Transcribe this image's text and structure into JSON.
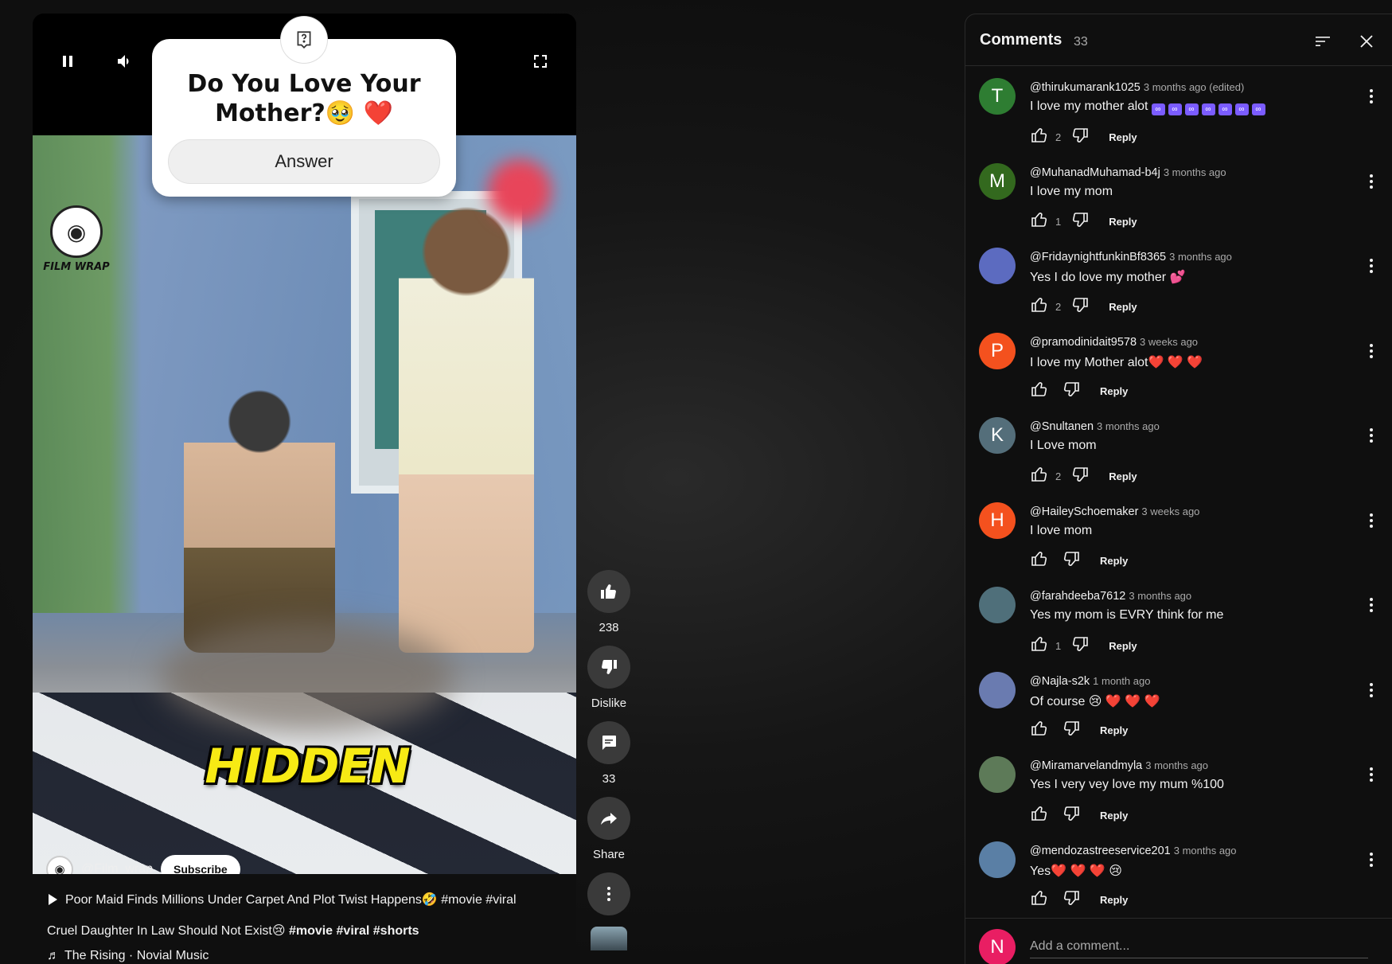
{
  "video": {
    "poll_question": "Do You Love Your Mother?🥹 ❤️",
    "poll_answer": "Answer",
    "logo_text": "FILM WRAP",
    "overlay_text": "HIDDEN",
    "channel_handle": "@Film_wrap",
    "subscribe_label": "Subscribe",
    "title": "Poor Maid Finds Millions Under Carpet And Plot Twist Happens🤣 #movie #viral",
    "description_plain": "Cruel Daughter In Law Should Not Exist😢 ",
    "description_tags": "#movie #viral #shorts",
    "music": "The Rising · Novial Music",
    "music_icon": "music-note-icon"
  },
  "actions": {
    "like_count": "238",
    "dislike_label": "Dislike",
    "comment_count": "33",
    "share_label": "Share"
  },
  "comments_panel": {
    "title": "Comments",
    "count": "33",
    "add_placeholder": "Add a comment...",
    "me_initial": "N",
    "reply_label": "Reply",
    "comments": [
      {
        "initial": "T",
        "avatar_color": "#2e7d32",
        "author": "@thirukumarank1025",
        "time": "3 months ago (edited)",
        "text": "I love my mother alot",
        "likes": "2",
        "pills": 7
      },
      {
        "initial": "M",
        "avatar_color": "#33691e",
        "author": "@MuhanadMuhamad-b4j",
        "time": "3 months ago",
        "text": "I love my mom",
        "likes": "1"
      },
      {
        "initial": "",
        "avatar_color": "#5c6bc0",
        "author": "@FridaynightfunkinBf8365",
        "time": "3 months ago",
        "text": "Yes I do love my mother 💕",
        "likes": "2"
      },
      {
        "initial": "P",
        "avatar_color": "#f4511e",
        "author": "@pramodinidait9578",
        "time": "3 weeks ago",
        "text": "I love my Mother alot❤️ ❤️ ❤️",
        "likes": ""
      },
      {
        "initial": "K",
        "avatar_color": "#546e7a",
        "author": "@Snultanen",
        "time": "3 months ago",
        "text": "I Love mom",
        "likes": "2"
      },
      {
        "initial": "H",
        "avatar_color": "#f4511e",
        "author": "@HaileySchoemaker",
        "time": "3 weeks ago",
        "text": "I love mom",
        "likes": ""
      },
      {
        "initial": "",
        "avatar_color": "#4f6f7a",
        "author": "@farahdeeba7612",
        "time": "3 months ago",
        "text": "Yes my mom is EVRY think for me",
        "likes": "1"
      },
      {
        "initial": "",
        "avatar_color": "#6a7bb0",
        "author": "@Najla-s2k",
        "time": "1 month ago",
        "text": "Of course 😢 ❤️ ❤️ ❤️",
        "likes": ""
      },
      {
        "initial": "",
        "avatar_color": "#5d7a58",
        "author": "@Miramarvelandmyla",
        "time": "3 months ago",
        "text": "Yes I very vey love my mum %100",
        "likes": ""
      },
      {
        "initial": "",
        "avatar_color": "#5a7fa5",
        "author": "@mendozastreeservice201",
        "time": "3 months ago",
        "text": "Yes❤️ ❤️ ❤️ 😢",
        "likes": ""
      }
    ]
  }
}
